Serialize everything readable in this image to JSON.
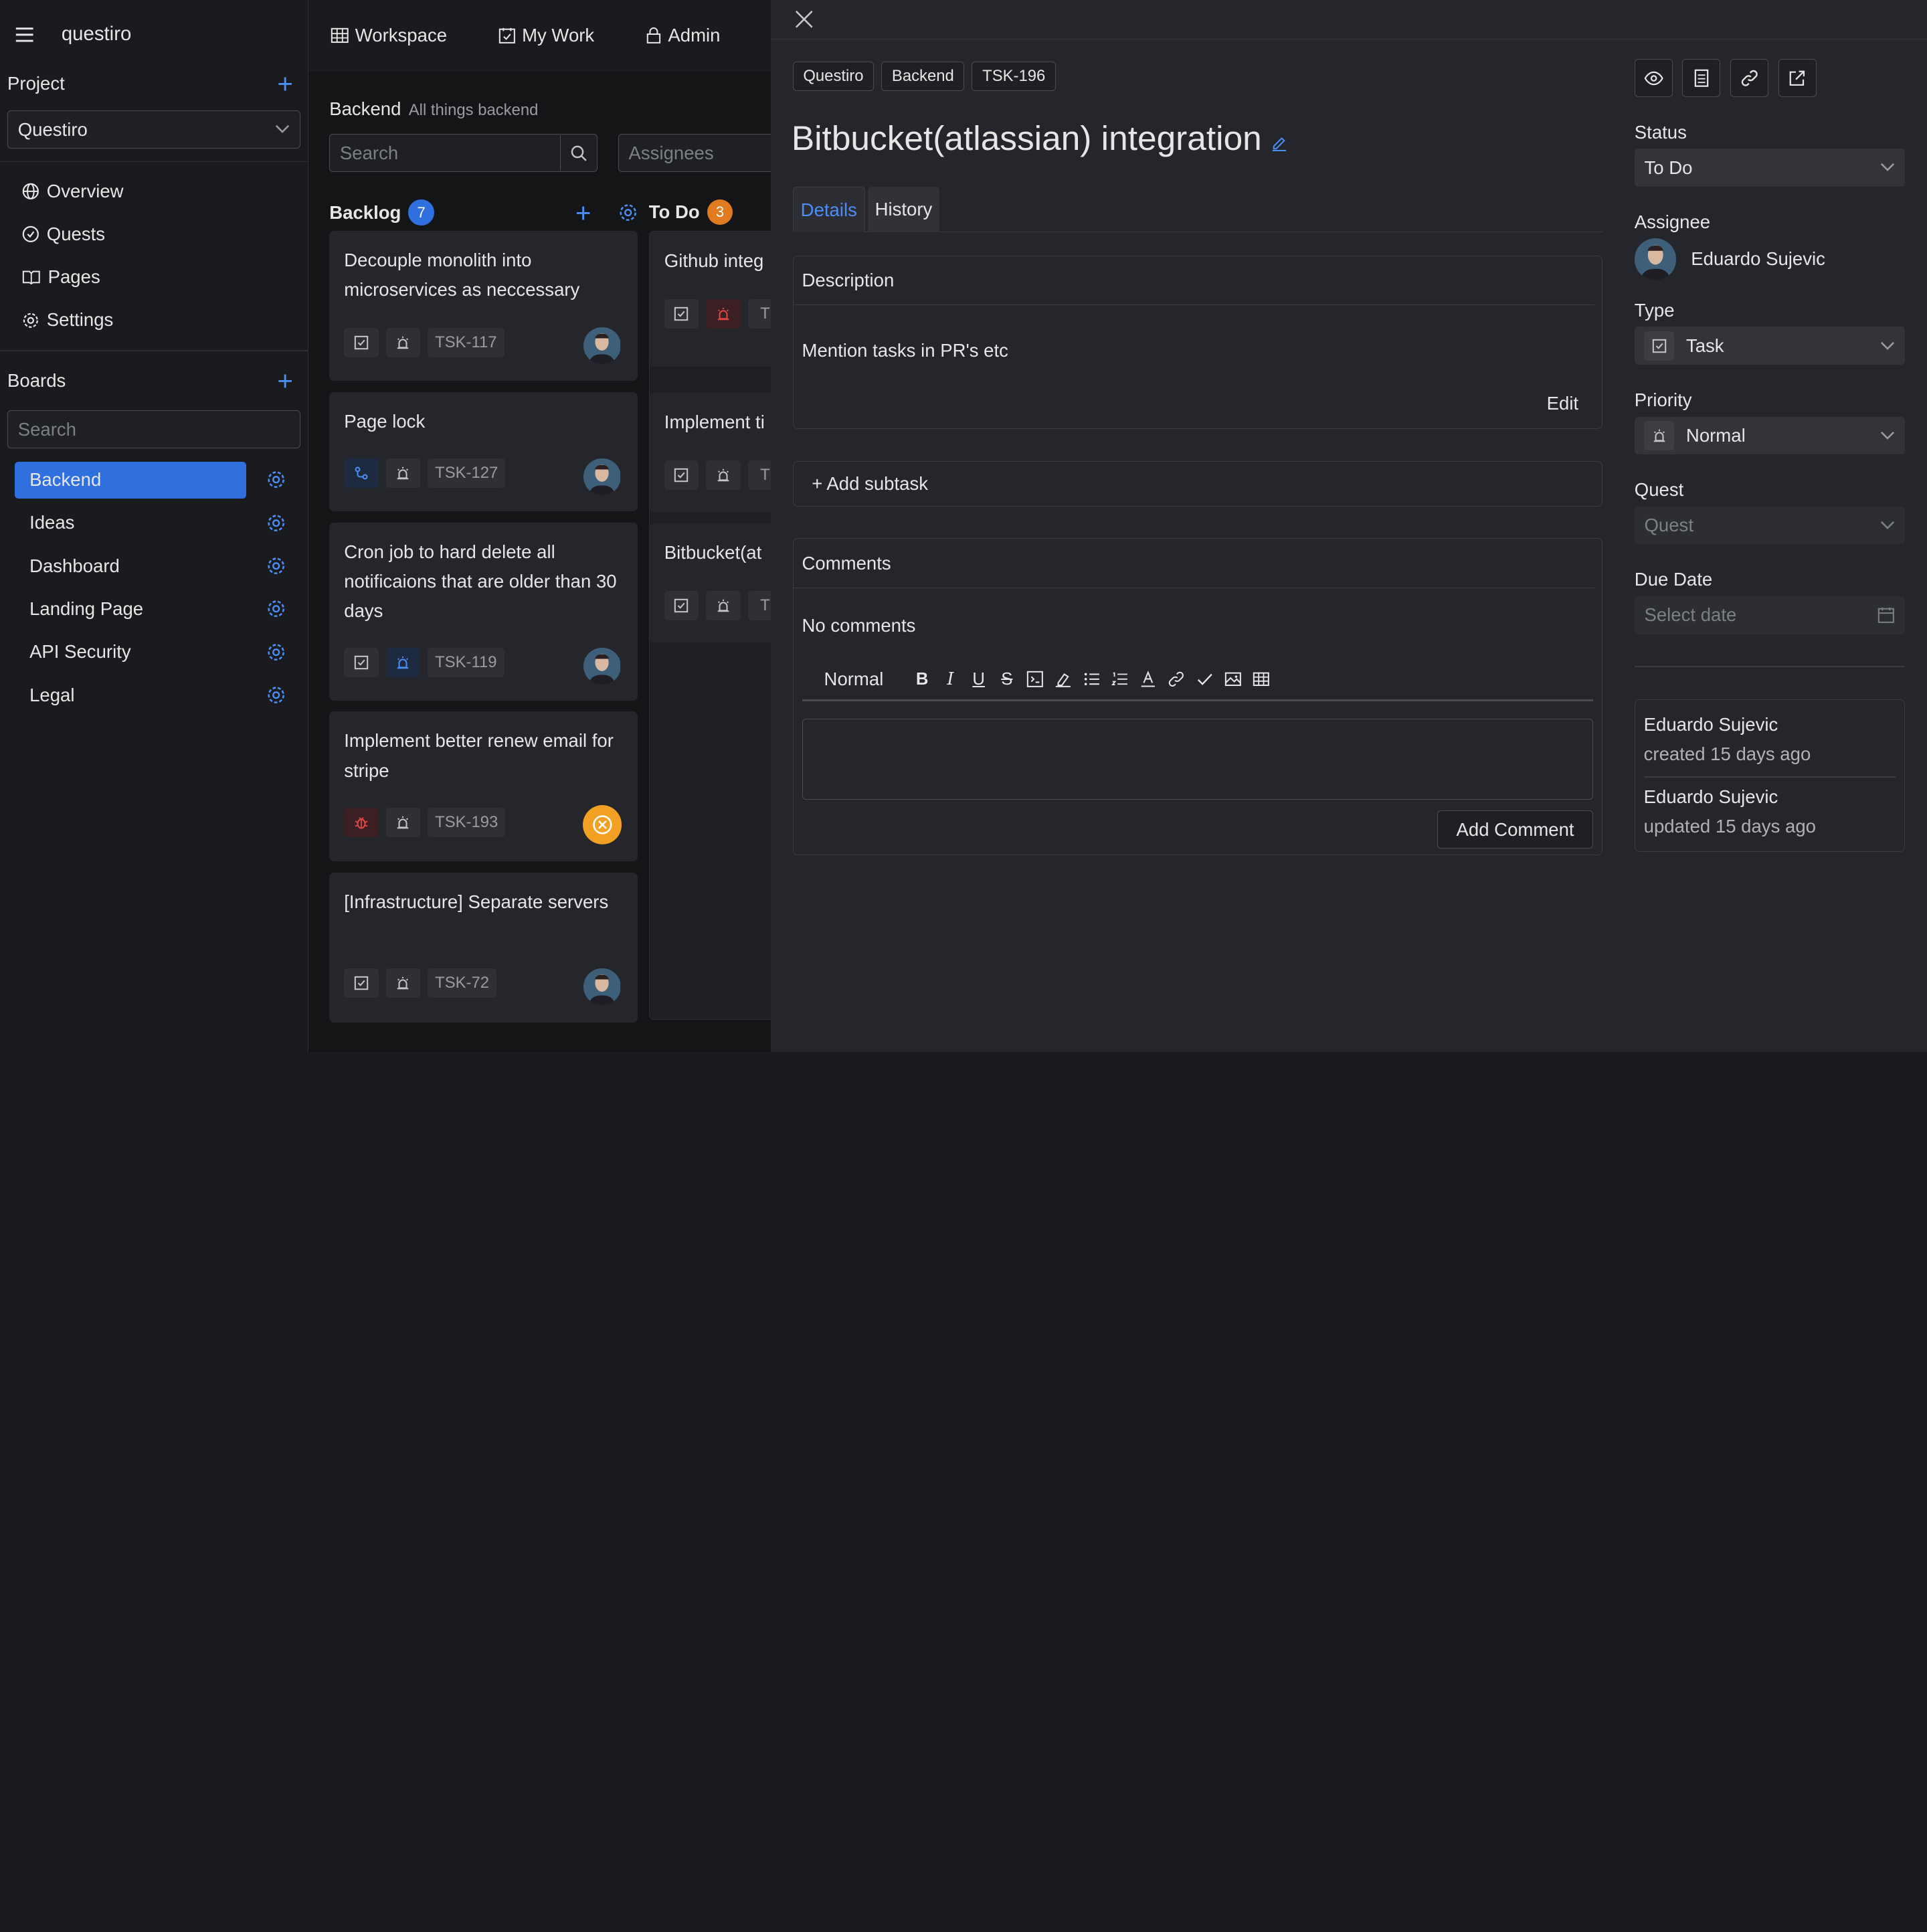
{
  "app": {
    "name": "questiro"
  },
  "topnav": {
    "workspace": "Workspace",
    "mywork": "My Work",
    "admin": "Admin"
  },
  "sidebar": {
    "project_label": "Project",
    "project_selected": "Questiro",
    "nav": [
      {
        "label": "Overview",
        "icon": "globe-icon"
      },
      {
        "label": "Quests",
        "icon": "check-circle-icon"
      },
      {
        "label": "Pages",
        "icon": "book-icon"
      },
      {
        "label": "Settings",
        "icon": "gear-icon"
      }
    ],
    "boards_label": "Boards",
    "search_placeholder": "Search",
    "boards": [
      "Backend",
      "Ideas",
      "Dashboard",
      "Landing Page",
      "API Security",
      "Legal"
    ],
    "active_board": "Backend"
  },
  "board": {
    "title": "Backend",
    "subtitle": "All things backend",
    "search_placeholder": "Search",
    "assignees_placeholder": "Assignees",
    "columns": [
      {
        "name": "Backlog",
        "count": "7",
        "badge_color": "#2f6fde",
        "cards": [
          {
            "title": "Decouple monolith into microservices as neccessary",
            "key": "TSK-117",
            "type": "task"
          },
          {
            "title": "Page lock",
            "key": "TSK-127",
            "type": "link"
          },
          {
            "title": "Cron job to hard delete all notificaions that are older than 30 days",
            "key": "TSK-119",
            "type": "task"
          },
          {
            "title": "Implement better renew email for stripe",
            "key": "TSK-193",
            "type": "bug"
          },
          {
            "title": "[Infrastructure] Separate servers",
            "key": "TSK-72",
            "type": "task"
          }
        ]
      },
      {
        "name": "To Do",
        "count": "3",
        "badge_color": "#e07b1f",
        "cards": [
          {
            "title": "Github integ",
            "key": "T"
          },
          {
            "title": "Implement ti",
            "key": "T"
          },
          {
            "title": "Bitbucket(at",
            "key": "T"
          }
        ]
      }
    ]
  },
  "detail": {
    "breadcrumbs": [
      "Questiro",
      "Backend",
      "TSK-196"
    ],
    "title": "Bitbucket(atlassian) integration",
    "tabs": [
      "Details",
      "History"
    ],
    "description_label": "Description",
    "description": "Mention tasks in PR's etc",
    "edit_label": "Edit",
    "add_subtask": "+ Add subtask",
    "comments_label": "Comments",
    "no_comments": "No comments",
    "format_style": "Normal",
    "add_comment": "Add Comment"
  },
  "fields": {
    "status_label": "Status",
    "status": "To Do",
    "assignee_label": "Assignee",
    "assignee": "Eduardo Sujevic",
    "type_label": "Type",
    "type": "Task",
    "priority_label": "Priority",
    "priority": "Normal",
    "quest_label": "Quest",
    "quest_placeholder": "Quest",
    "due_label": "Due Date",
    "due_placeholder": "Select date"
  },
  "activity": [
    {
      "user": "Eduardo Sujevic",
      "action": "created 15 days ago"
    },
    {
      "user": "Eduardo Sujevic",
      "action": "updated 15 days ago"
    }
  ]
}
